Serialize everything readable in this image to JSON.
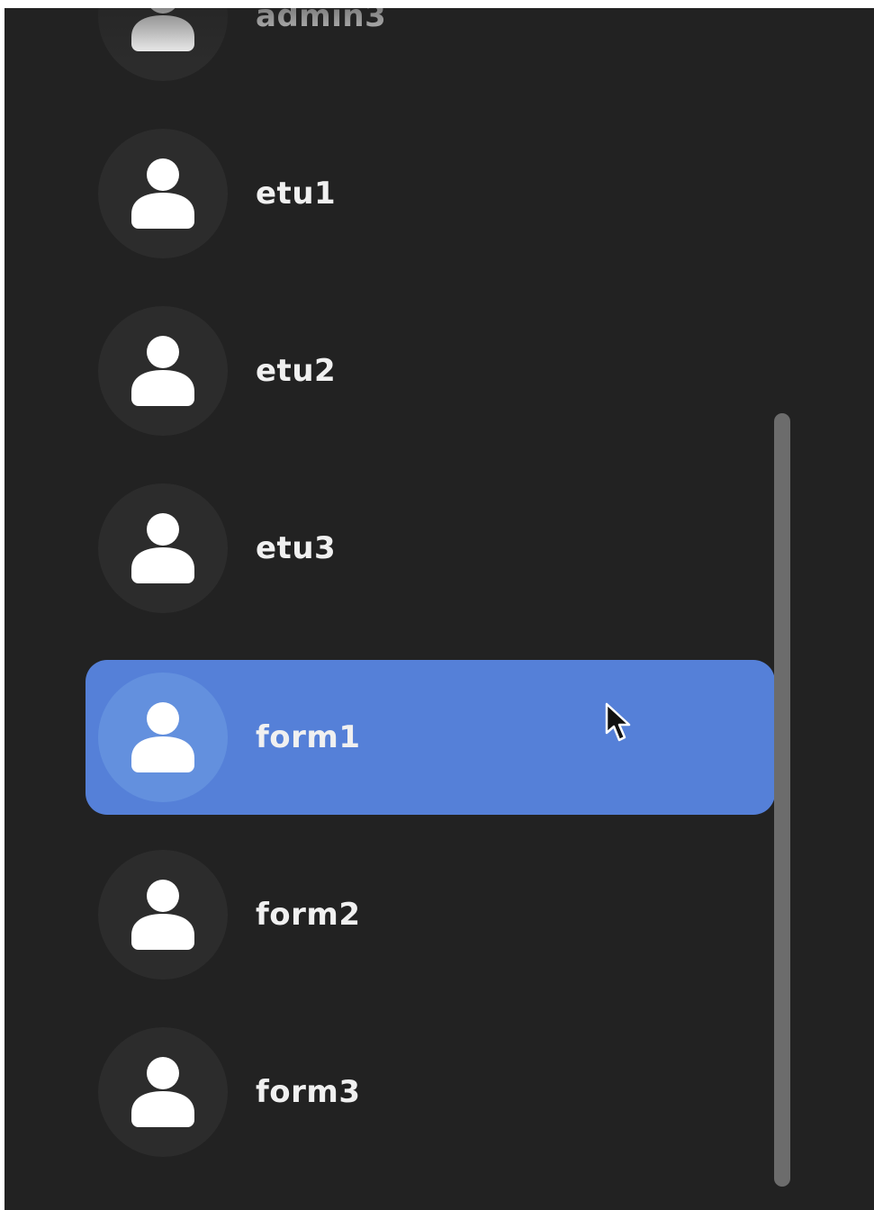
{
  "user_list": {
    "users": [
      {
        "name": "admin3",
        "selected": false
      },
      {
        "name": "etu1",
        "selected": false
      },
      {
        "name": "etu2",
        "selected": false
      },
      {
        "name": "etu3",
        "selected": false
      },
      {
        "name": "form1",
        "selected": true
      },
      {
        "name": "form2",
        "selected": false
      },
      {
        "name": "form3",
        "selected": false
      }
    ],
    "avatar_icon": "person-icon"
  },
  "colors": {
    "background": "#222222",
    "avatar_circle": "#2c2c2c",
    "selection": "#5580d8",
    "text": "#f0f0f0",
    "scrollbar": "#6c6c6c"
  }
}
